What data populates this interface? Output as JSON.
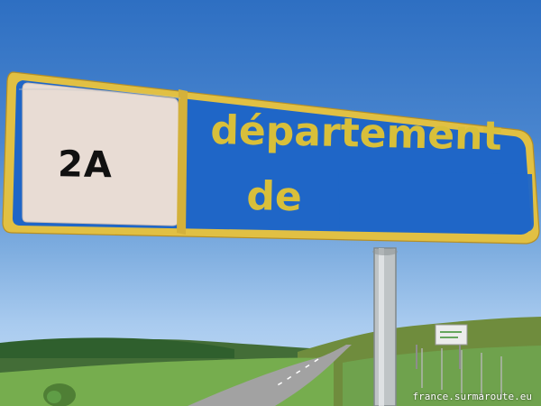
{
  "sign": {
    "code": "2A",
    "line1": "département",
    "line2": "de"
  },
  "watermark": {
    "text": "france.surmaroute.eu"
  },
  "colors": {
    "sky": "#4a86cf",
    "sign_blue": "#1f66c7",
    "sign_border_yellow": "#d4b13a",
    "sign_text_yellow": "#d8bf3a",
    "code_panel": "#e8dcd4",
    "grass": "#5f9d46",
    "road": "#8b8b8b"
  },
  "icons": {
    "sign": "roadside-sign",
    "billboard": "small-billboard-icon",
    "bush": "green-bush-icon"
  }
}
